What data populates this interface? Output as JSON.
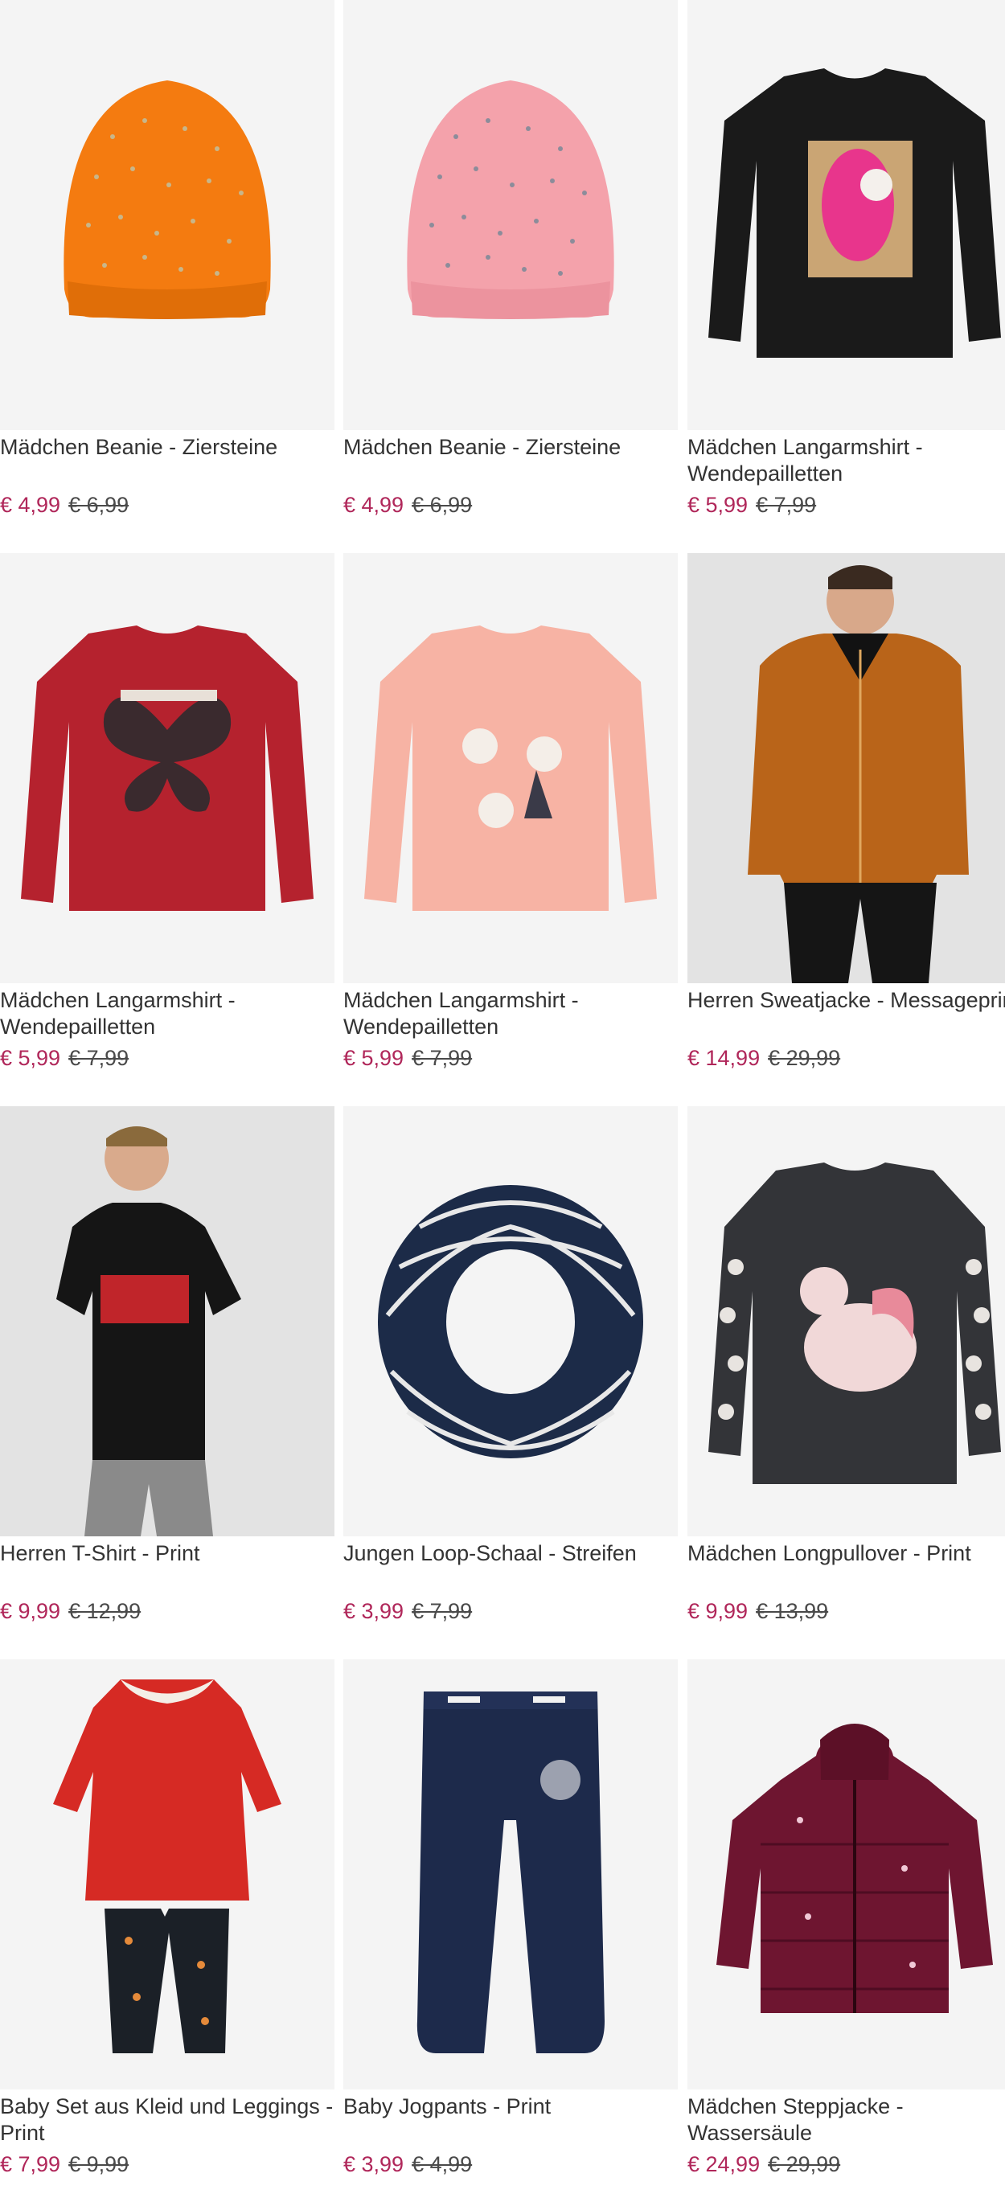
{
  "products": [
    {
      "title": "Mädchen Beanie - Ziersteine",
      "price": "€ 4,99",
      "old_price": "€ 6,99",
      "image": "beanie-orange-icon",
      "color": "#f47b10"
    },
    {
      "title": "Mädchen Beanie - Ziersteine",
      "price": "€ 4,99",
      "old_price": "€ 6,99",
      "image": "beanie-pink-icon",
      "color": "#f4a2ab"
    },
    {
      "title": "Mädchen Langarmshirt -\nWendepailletten",
      "price": "€ 5,99",
      "old_price": "€ 7,99",
      "image": "black-longsleeve-magic-unicorn-icon",
      "color": "#1a1a1a"
    },
    {
      "title": "Mädchen Langarmshirt -\nWendepailletten",
      "price": "€ 5,99",
      "old_price": "€ 7,99",
      "image": "red-longsleeve-butterfly-icon",
      "color": "#b5222e"
    },
    {
      "title": "Mädchen Langarmshirt -\nWendepailletten",
      "price": "€ 5,99",
      "old_price": "€ 7,99",
      "image": "peach-longsleeve-mice-icon",
      "color": "#f7b3a4"
    },
    {
      "title": "Herren Sweatjacke - Messageprin",
      "price": "€ 14,99",
      "old_price": "€ 29,99",
      "image": "man-orange-hoodie-icon",
      "color": "#b96419"
    },
    {
      "title": "Herren T-Shirt - Print",
      "price": "€ 9,99",
      "old_price": "€ 12,99",
      "image": "man-black-tshirt-icon",
      "color": "#151515"
    },
    {
      "title": "Jungen Loop-Schaal - Streifen",
      "price": "€ 3,99",
      "old_price": "€ 7,99",
      "image": "striped-loop-scarf-icon",
      "color": "#1c2b48"
    },
    {
      "title": "Mädchen Longpullover - Print",
      "price": "€ 9,99",
      "old_price": "€ 13,99",
      "image": "grey-longpullover-unicorn-icon",
      "color": "#333438"
    },
    {
      "title": "Baby Set aus Kleid und Leggings -\nPrint",
      "price": "€ 7,99",
      "old_price": "€ 9,99",
      "image": "red-dress-leggings-set-icon",
      "color": "#d62a24"
    },
    {
      "title": "Baby Jogpants - Print",
      "price": "€ 3,99",
      "old_price": "€ 4,99",
      "image": "navy-jogpants-icon",
      "color": "#1d2a4b"
    },
    {
      "title": "Mädchen Steppjacke -\nWassersäule",
      "price": "€ 24,99",
      "old_price": "€ 29,99",
      "image": "burgundy-puffer-jacket-icon",
      "color": "#6e1530"
    }
  ]
}
